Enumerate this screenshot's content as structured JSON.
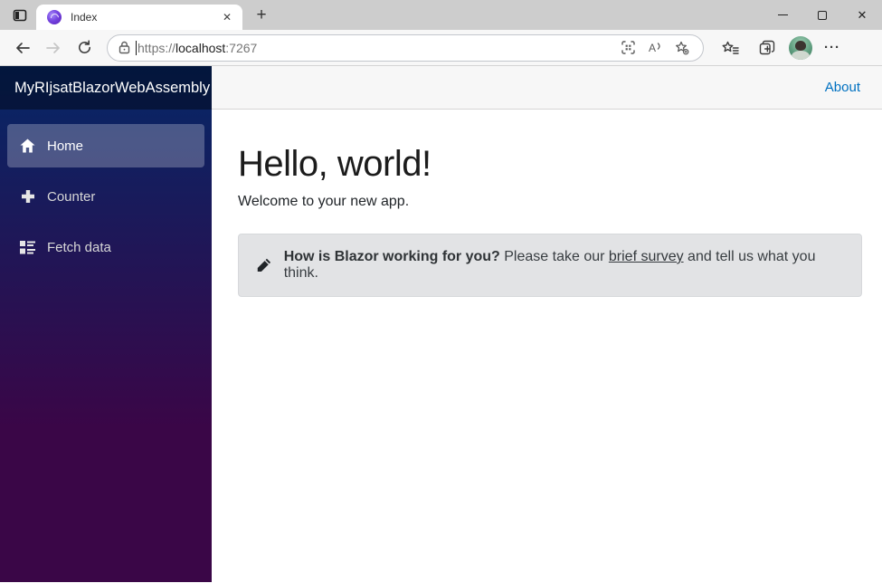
{
  "browser": {
    "tab_title": "Index",
    "tab_close_glyph": "✕",
    "new_tab_glyph": "+",
    "window_close_glyph": "✕",
    "menu_glyph": "···",
    "url": {
      "scheme": "https://",
      "host": "localhost",
      "port": ":7267"
    }
  },
  "app": {
    "brand": "MyRIjsatBlazorWebAssembly",
    "nav": [
      {
        "label": "Home",
        "icon": "home-icon",
        "active": true
      },
      {
        "label": "Counter",
        "icon": "plus-icon",
        "active": false
      },
      {
        "label": "Fetch data",
        "icon": "list-rich-icon",
        "active": false
      }
    ],
    "about_label": "About",
    "heading": "Hello, world!",
    "welcome": "Welcome to your new app.",
    "survey": {
      "bold": "How is Blazor working for you?",
      "pre_link": " Please take our ",
      "link": "brief survey",
      "post_link": " and tell us what you think."
    }
  },
  "colors": {
    "sidebar_gradient_top": "#052767",
    "sidebar_gradient_bottom": "#3a0647",
    "active_nav_bg": "rgba(255,255,255,0.25)",
    "about_link": "#0071c1",
    "alert_bg": "#e2e3e5",
    "favicon_purple": "#7444e0"
  }
}
